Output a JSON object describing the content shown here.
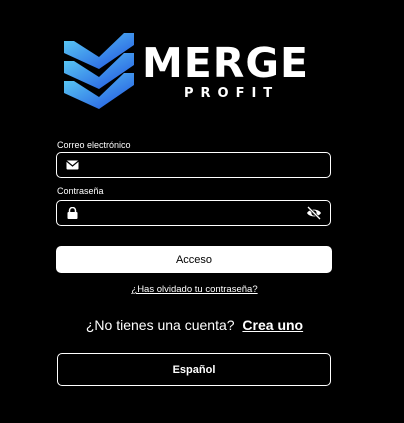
{
  "brand": {
    "name": "MERGE",
    "tagline": "PROFIT",
    "colors": {
      "chevron_light": "#5fd3f5",
      "chevron_dark": "#1f4fe0"
    }
  },
  "form": {
    "email": {
      "label": "Correo electrónico",
      "value": "",
      "icon": "envelope-icon"
    },
    "password": {
      "label": "Contraseña",
      "value": "",
      "icon": "lock-icon",
      "toggle_icon": "eye-slash-icon"
    },
    "login_label": "Acceso",
    "forgot_label": "¿Has olvidado tu contraseña?"
  },
  "signup": {
    "prompt": "¿No tienes una cuenta?",
    "link_label": "Crea uno"
  },
  "language": {
    "selected": "Español"
  }
}
